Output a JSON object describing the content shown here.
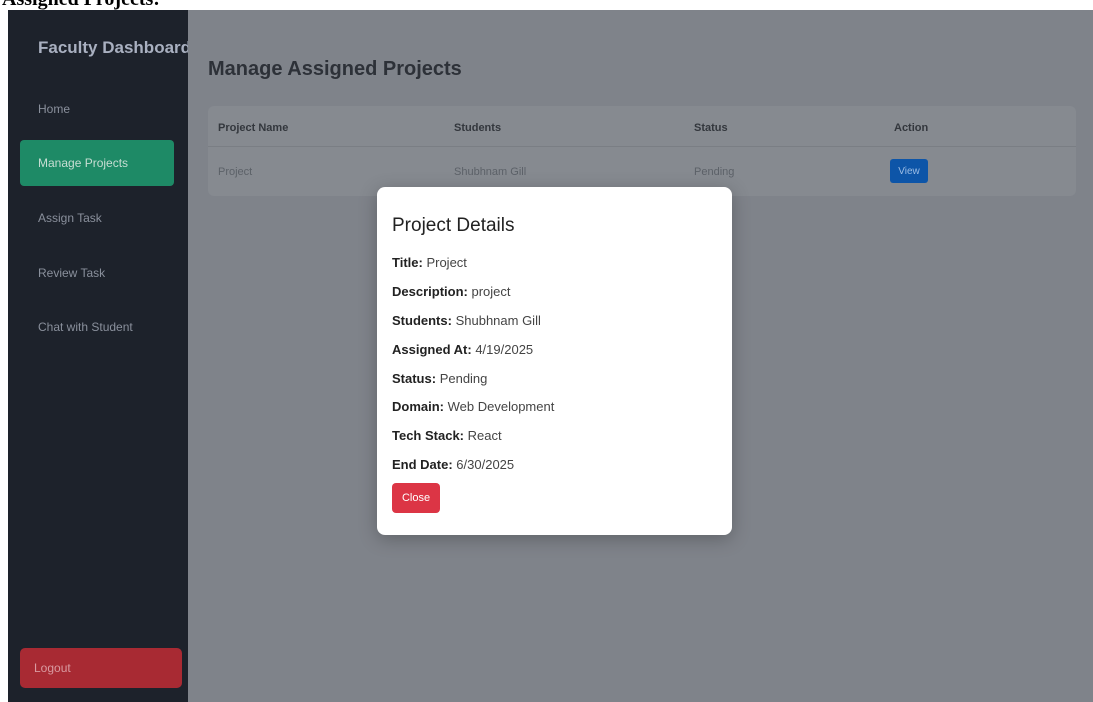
{
  "caption": "Assigned Projects:",
  "sidebar": {
    "brand": "Faculty Dashboard",
    "items": [
      {
        "label": "Home"
      },
      {
        "label": "Manage Projects"
      },
      {
        "label": "Assign Task"
      },
      {
        "label": "Review Task"
      },
      {
        "label": "Chat with Student"
      }
    ],
    "logout": "Logout"
  },
  "main": {
    "title": "Manage Assigned Projects",
    "table": {
      "headers": [
        "Project Name",
        "Students",
        "Status",
        "Action"
      ],
      "rows": [
        {
          "project": "Project",
          "students": "Shubhnam Gill",
          "status": "Pending",
          "action": "View"
        }
      ]
    }
  },
  "modal": {
    "title": "Project Details",
    "fields": [
      {
        "label": "Title:",
        "value": "Project"
      },
      {
        "label": "Description:",
        "value": "project"
      },
      {
        "label": "Students:",
        "value": "Shubhnam Gill"
      },
      {
        "label": "Assigned At:",
        "value": "4/19/2025"
      },
      {
        "label": "Status:",
        "value": "Pending"
      },
      {
        "label": "Domain:",
        "value": "Web Development"
      },
      {
        "label": "Tech Stack:",
        "value": "React"
      },
      {
        "label": "End Date:",
        "value": "6/30/2025"
      }
    ],
    "close": "Close"
  },
  "colors": {
    "sidebar_bg": "#1d222b",
    "active_nav": "#1e8a66",
    "logout": "#a82a33",
    "view_button": "#0d55a8",
    "close_button": "#dc3545"
  }
}
